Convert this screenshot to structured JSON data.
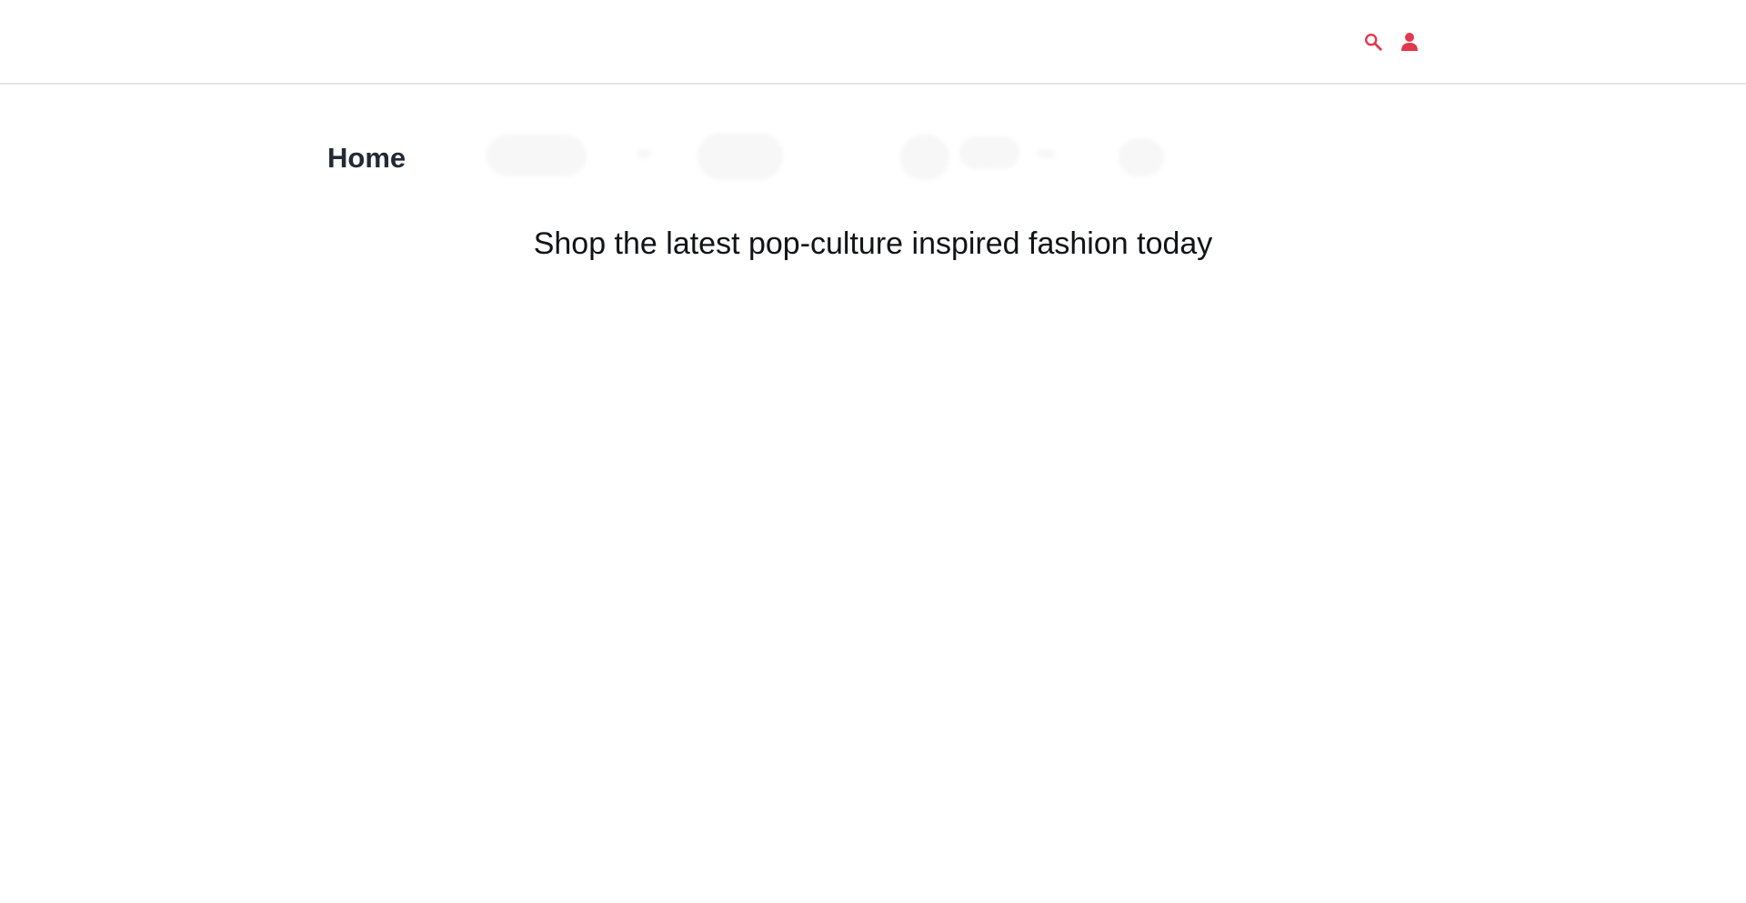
{
  "header": {
    "icons": [
      {
        "name": "search-icon",
        "color": "#e0384c"
      },
      {
        "name": "user-icon",
        "color": "#e0384c"
      }
    ]
  },
  "main": {
    "title": "Home",
    "tagline": "Shop the latest pop-culture inspired fashion today"
  },
  "colors": {
    "accent": "#e0384c",
    "title": "#232a36",
    "divider": "#e4e5e7"
  }
}
